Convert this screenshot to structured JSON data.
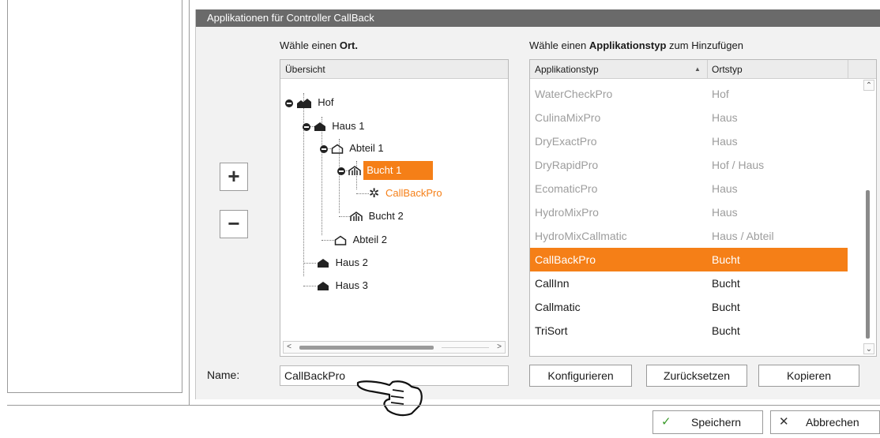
{
  "dialog": {
    "title": "Applikationen für Controller CallBack"
  },
  "location": {
    "heading_prefix": "Wähle einen ",
    "heading_bold": "Ort."
  },
  "tree": {
    "header": "Übersicht",
    "nodes": [
      {
        "label": "Hof",
        "icon": "farm-icon"
      },
      {
        "label": "Haus 1",
        "icon": "house-filled-icon"
      },
      {
        "label": "Abteil 1",
        "icon": "house-outline-icon"
      },
      {
        "label": "Bucht 1",
        "icon": "pen-icon"
      },
      {
        "label": "CallBackPro",
        "icon": "gear-icon"
      },
      {
        "label": "Bucht 2",
        "icon": "pen-icon"
      },
      {
        "label": "Abteil 2",
        "icon": "house-outline-icon"
      },
      {
        "label": "Haus 2",
        "icon": "house-filled-icon"
      },
      {
        "label": "Haus 3",
        "icon": "house-filled-icon"
      }
    ]
  },
  "apptype": {
    "heading_prefix": "Wähle einen ",
    "heading_bold": "Applikationstyp",
    "heading_suffix": " zum Hinzufügen",
    "columns": [
      "Applikationstyp",
      "Ortstyp"
    ],
    "rows": [
      {
        "name": "WaterCheckPro",
        "ort": "Hof",
        "state": "dim"
      },
      {
        "name": "CulinaMixPro",
        "ort": "Haus",
        "state": "dim"
      },
      {
        "name": "DryExactPro",
        "ort": "Haus",
        "state": "dim"
      },
      {
        "name": "DryRapidPro",
        "ort": "Hof / Haus",
        "state": "dim"
      },
      {
        "name": "EcomaticPro",
        "ort": "Haus",
        "state": "dim"
      },
      {
        "name": "HydroMixPro",
        "ort": "Haus",
        "state": "dim"
      },
      {
        "name": "HydroMixCallmatic",
        "ort": "Haus / Abteil",
        "state": "dim"
      },
      {
        "name": "CallBackPro",
        "ort": "Bucht",
        "state": "selected"
      },
      {
        "name": "CallInn",
        "ort": "Bucht",
        "state": "normal"
      },
      {
        "name": "Callmatic",
        "ort": "Bucht",
        "state": "normal"
      },
      {
        "name": "TriSort",
        "ort": "Bucht",
        "state": "normal"
      }
    ]
  },
  "side_buttons": {
    "add": "+",
    "remove": "−"
  },
  "name_field": {
    "label": "Name:",
    "value": "CallBackPro"
  },
  "actions": {
    "configure": "Konfigurieren",
    "reset": "Zurücksetzen",
    "copy": "Kopieren"
  },
  "footer": {
    "save": "Speichern",
    "cancel": "Abbrechen",
    "save_icon": "✓",
    "cancel_icon": "✕"
  },
  "colors": {
    "accent": "#f57f17",
    "title_bar": "#6a6a6a"
  }
}
